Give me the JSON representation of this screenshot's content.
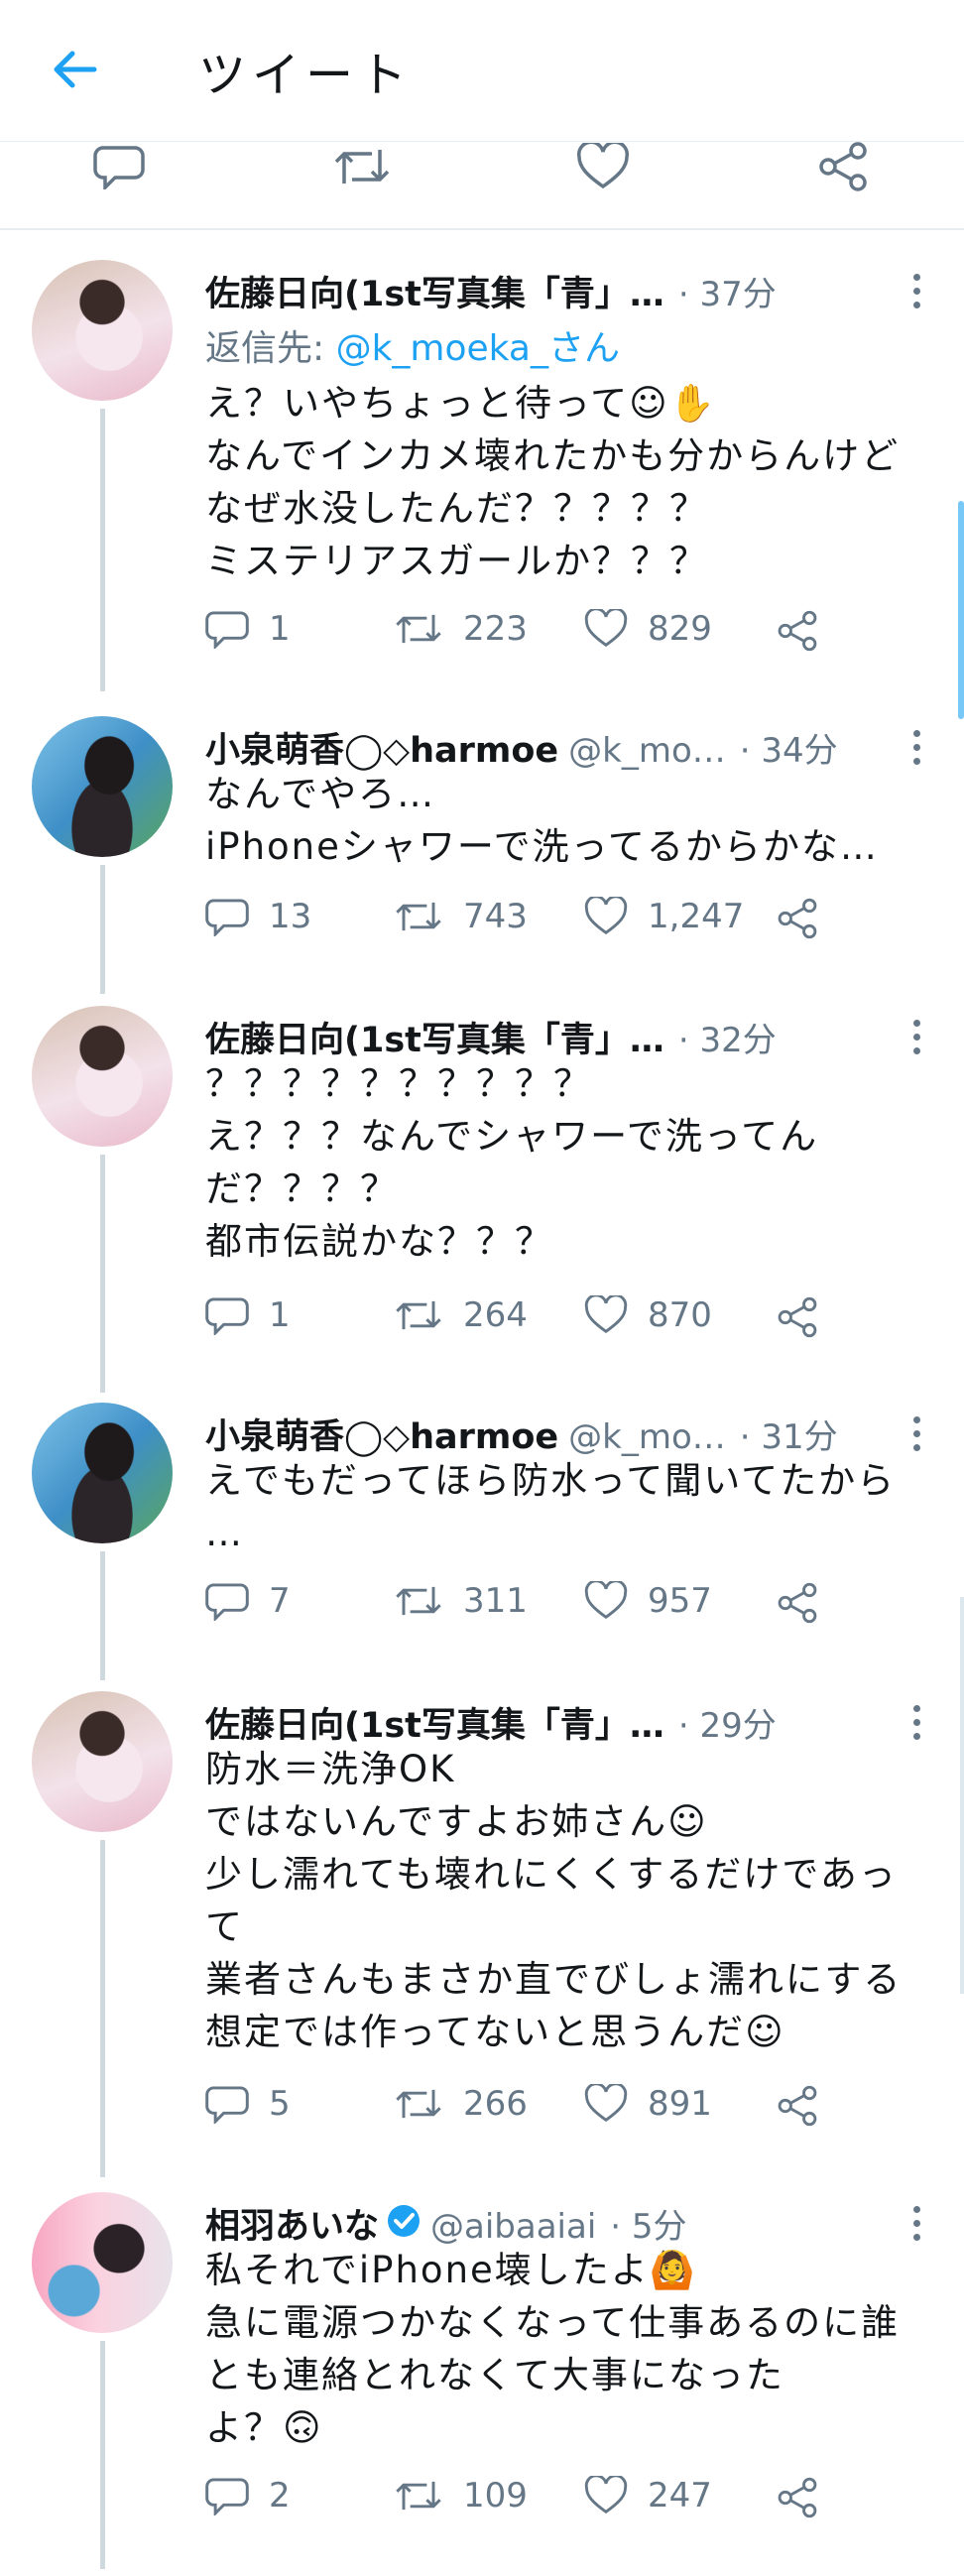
{
  "header": {
    "title": "ツイート",
    "back_icon": "arrow-left-icon"
  },
  "action_bar": {
    "icons": [
      "reply-icon",
      "retweet-icon",
      "like-icon",
      "share-icon"
    ]
  },
  "tweets": [
    {
      "name": "佐藤日向(1st写真集「青」…",
      "handle": "",
      "time": "· 37分",
      "reply_prefix": "返信先: ",
      "reply_to": "@k_moeka_さん",
      "text": "え？いやちょっと待って\nなんでインカメ壊れたかも分からんけど\nなぜ水没したんだ？？？？？\nミステリアスガールか？？？",
      "emoji": "☺✋",
      "replies": "1",
      "retweets": "223",
      "likes": "829"
    },
    {
      "name": "小泉萌香◯◇harmoe",
      "handle": "@k_mo…",
      "time": "· 34分",
      "text": "なんでやろ…\niPhoneシャワーで洗ってるからかな…",
      "replies": "13",
      "retweets": "743",
      "likes": "1,247"
    },
    {
      "name": "佐藤日向(1st写真集「青」…",
      "handle": "",
      "time": "· 32分",
      "text": "？？？？？？？？？？\nえ？？？なんでシャワーで洗ってん\nだ？？？？\n都市伝説かな？？？",
      "replies": "1",
      "retweets": "264",
      "likes": "870"
    },
    {
      "name": "小泉萌香◯◇harmoe",
      "handle": "@k_mo…",
      "time": "· 31分",
      "text": "えでもだってほら防水って聞いてたから\n…",
      "replies": "7",
      "retweets": "311",
      "likes": "957"
    },
    {
      "name": "佐藤日向(1st写真集「青」…",
      "handle": "",
      "time": "· 29分",
      "text": "防水＝洗浄OK\nではないんですよお姉さん☺\n少し濡れても壊れにくくするだけであっ\nて\n業者さんもまさか直でびしょ濡れにする\n想定では作ってないと思うんだ☺",
      "replies": "5",
      "retweets": "266",
      "likes": "891"
    },
    {
      "name": "相羽あいな",
      "handle": "@aibaaiai",
      "time": "· 5分",
      "text": "私それでiPhone壊したよ🙆\n急に電源つかなくなって仕事あるのに誰\nとも連絡とれなくて大事になった\nよ？🙃",
      "replies": "2",
      "retweets": "109",
      "likes": "247"
    }
  ],
  "colors": {
    "accent": "#1da1f2",
    "muted": "#657786",
    "text": "#14171a",
    "divider": "#e6ecf0"
  }
}
